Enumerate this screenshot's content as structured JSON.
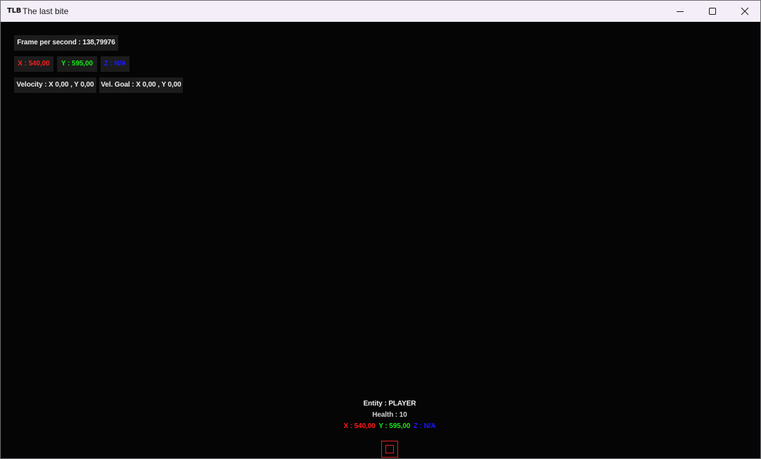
{
  "window": {
    "icon_text": "TLB",
    "title": "The last bite"
  },
  "hud": {
    "fps": "Frame per second : 138,79976",
    "pos_x": "X : 540,00",
    "pos_y": "Y : 595,00",
    "pos_z": "Z : N/A",
    "velocity": "Velocity : X 0,00 , Y 0,00",
    "vel_goal": "Vel. Goal : X 0,00 , Y 0,00"
  },
  "entity": {
    "name": "Entity : PLAYER",
    "health": "Health : 10",
    "x": "X : 540,00",
    "y": "Y : 595,00",
    "z": "Z : N/A"
  },
  "colors": {
    "x_axis": "#ff1a1a",
    "y_axis": "#19e619",
    "z_axis": "#1a1aff",
    "player_outline": "#e02020",
    "background": "#050505",
    "hud_box": "#1c1c1c"
  },
  "icons": {
    "minimize": "minimize-icon",
    "maximize": "maximize-icon",
    "close": "close-icon"
  }
}
